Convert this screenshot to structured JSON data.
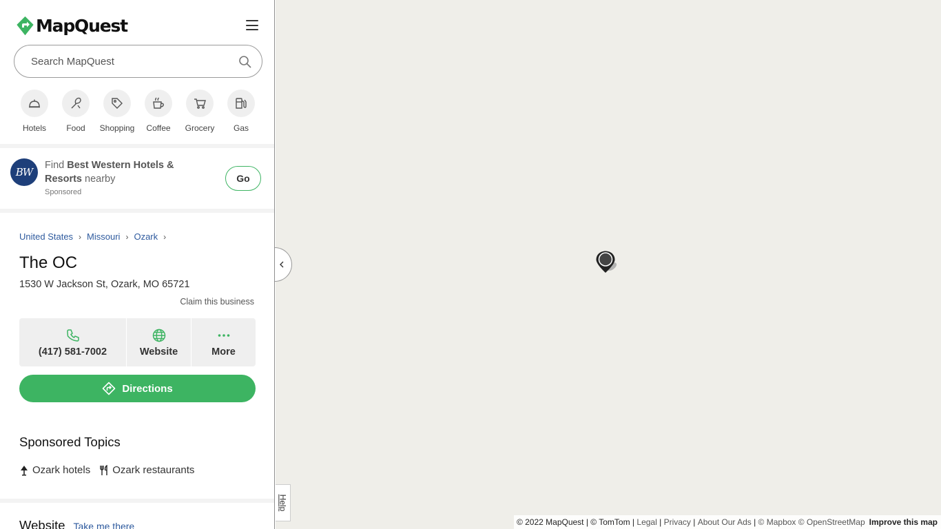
{
  "brand": {
    "name": "MapQuest"
  },
  "search": {
    "placeholder": "Search MapQuest"
  },
  "categories": [
    {
      "label": "Hotels",
      "icon": "hotel-bell-icon"
    },
    {
      "label": "Food",
      "icon": "food-utensils-icon"
    },
    {
      "label": "Shopping",
      "icon": "shopping-tag-icon"
    },
    {
      "label": "Coffee",
      "icon": "coffee-cup-icon"
    },
    {
      "label": "Grocery",
      "icon": "grocery-cart-icon"
    },
    {
      "label": "Gas",
      "icon": "gas-pump-icon"
    }
  ],
  "ad": {
    "logo_text": "BW",
    "prefix": "Find",
    "brand": "Best Western Hotels & Resorts",
    "suffix": "nearby",
    "sponsored": "Sponsored",
    "button": "Go"
  },
  "breadcrumb": [
    "United States",
    "Missouri",
    "Ozark"
  ],
  "place": {
    "name": "The OC",
    "address": "1530 W Jackson St, Ozark, MO 65721",
    "claim": "Claim this business"
  },
  "actions": {
    "phone": "(417) 581-7002",
    "website": "Website",
    "more": "More"
  },
  "directions": "Directions",
  "sponsored_topics": {
    "title": "Sponsored Topics",
    "items": [
      "Ozark hotels",
      "Ozark restaurants"
    ]
  },
  "website_section": {
    "heading": "Website",
    "link": "Take me there"
  },
  "map": {
    "help": "Help",
    "attribution": {
      "copyright": "© 2022 MapQuest | © TomTom |",
      "legal": "Legal",
      "privacy": "Privacy",
      "ads": "About Our Ads",
      "sources": "© Mapbox © OpenStreetMap",
      "improve": "Improve this map"
    }
  },
  "colors": {
    "accent": "#3db462",
    "link": "#2e5a9e",
    "map_bg": "#efeee9",
    "bw_blue": "#1e3f7a"
  }
}
